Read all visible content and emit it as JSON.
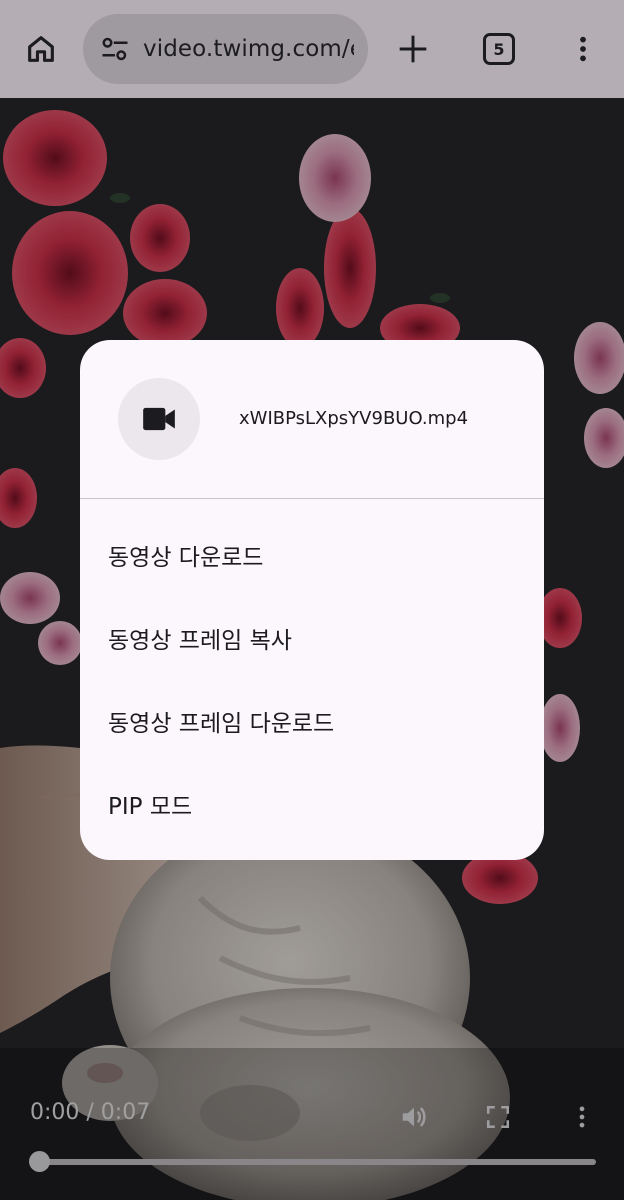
{
  "toolbar": {
    "url": "video.twimg.com/ex",
    "tab_count": "5",
    "icons": {
      "home": "home-icon",
      "site_settings": "tune-icon",
      "new_tab": "plus-icon",
      "menu": "more-vert-icon"
    }
  },
  "player": {
    "time": "0:00 / 0:07",
    "progress": 0.0,
    "icons": {
      "volume": "volume-icon",
      "fullscreen": "fullscreen-icon",
      "more": "more-vert-icon"
    }
  },
  "popup": {
    "file_name": "xWIBPsLXpsYV9BUO.mp4",
    "icon": "videocam-icon",
    "menu": [
      {
        "label": "동영상 다운로드"
      },
      {
        "label": "동영상 프레임 복사"
      },
      {
        "label": "동영상 프레임 다운로드"
      },
      {
        "label": "PIP 모드"
      }
    ]
  },
  "colors": {
    "toolbar_bg": "#b4aeb4",
    "omnibox_bg": "#9f9aa0",
    "popup_bg": "#fcf6fd",
    "flower_red": "#d8324e",
    "flower_pink": "#e6a2bd",
    "fabric_dark": "#25252a"
  }
}
